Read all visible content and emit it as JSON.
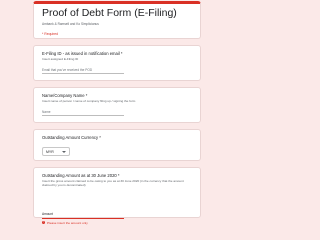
{
  "form": {
    "title": "Proof of Debt Form (E-Filing)",
    "organization": "Ambank & Ramsell and Ko Simplicianus",
    "required_note": "* Required"
  },
  "questions": {
    "email": {
      "title": "E-Filing ID - as issued in notification email *",
      "help": "Insert assigned E-Filing ID",
      "placeholder": "Email that you've received the POD"
    },
    "name": {
      "title": "Name/Company Name *",
      "help": "Insert name of person / name of company filing up / signing the form",
      "placeholder": "Name"
    },
    "currency": {
      "title": "Outstanding Amount Currency *",
      "selected": "MYR"
    },
    "amount": {
      "title": "Outstanding Amount as at 30 June 2020 *",
      "help_line1": "Insert the gross amount claimed to be owing to you as at 30 June 2020 (in the currency that the amount",
      "help_line2": "claimed by you is denominated)",
      "value": "Amount",
      "error": "Please insert the amount only"
    }
  }
}
